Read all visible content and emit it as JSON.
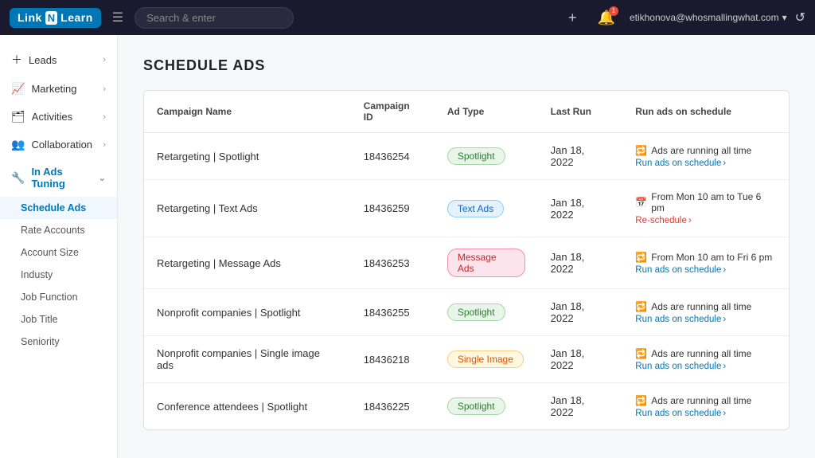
{
  "app": {
    "logo_text_left": "Link",
    "logo_n": "N",
    "logo_text_right": "Learn"
  },
  "topnav": {
    "search_placeholder": "Search & enter",
    "plus_icon": "+",
    "notification_count": "1",
    "user_email": "etikhonova@whosmallingwhat.com",
    "chevron": "▾",
    "refresh_icon": "↺"
  },
  "sidebar": {
    "items": [
      {
        "id": "leads",
        "label": "Leads",
        "icon": "＋",
        "has_chevron": true
      },
      {
        "id": "marketing",
        "label": "Marketing",
        "icon": "📈",
        "has_chevron": true
      },
      {
        "id": "activities",
        "label": "Activities",
        "icon": "🗂",
        "has_chevron": true
      },
      {
        "id": "collaboration",
        "label": "Collaboration",
        "icon": "👥",
        "has_chevron": true
      },
      {
        "id": "in-ads-tuning",
        "label": "In Ads Tuning",
        "icon": "🔧",
        "active": true,
        "has_chevron": true
      }
    ],
    "subitems": [
      {
        "id": "schedule-ads",
        "label": "Schedule Ads",
        "active": true
      },
      {
        "id": "rate-accounts",
        "label": "Rate Accounts"
      },
      {
        "id": "account-size",
        "label": "Account Size"
      },
      {
        "id": "industy",
        "label": "Industy"
      },
      {
        "id": "job-function",
        "label": "Job Function"
      },
      {
        "id": "job-title",
        "label": "Job Title"
      },
      {
        "id": "seniority",
        "label": "Seniority"
      }
    ]
  },
  "page": {
    "title": "SCHEDULE ADS"
  },
  "table": {
    "columns": [
      "Campaign Name",
      "Campaign ID",
      "Ad Type",
      "Last Run",
      "Run ads on schedule"
    ],
    "rows": [
      {
        "campaign_name": "Retargeting | Spotlight",
        "campaign_id": "18436254",
        "ad_type": "Spotlight",
        "ad_type_class": "spotlight",
        "last_run": "Jan 18, 2022",
        "schedule_title": "Ads are running all time",
        "schedule_link": "Run ads on schedule",
        "schedule_link_class": "normal",
        "icon": "🔁"
      },
      {
        "campaign_name": "Retargeting | Text Ads",
        "campaign_id": "18436259",
        "ad_type": "Text Ads",
        "ad_type_class": "text-ads",
        "last_run": "Jan 18, 2022",
        "schedule_title": "From Mon 10 am to Tue 6 pm",
        "schedule_link": "Re-schedule",
        "schedule_link_class": "reschedule",
        "icon": "📅"
      },
      {
        "campaign_name": "Retargeting | Message Ads",
        "campaign_id": "18436253",
        "ad_type": "Message Ads",
        "ad_type_class": "message-ads",
        "last_run": "Jan 18, 2022",
        "schedule_title": "From Mon 10 am to Fri 6 pm",
        "schedule_link": "Run ads on schedule",
        "schedule_link_class": "normal",
        "icon": "🔁"
      },
      {
        "campaign_name": "Nonprofit companies | Spotlight",
        "campaign_id": "18436255",
        "ad_type": "Spotlight",
        "ad_type_class": "spotlight",
        "last_run": "Jan 18, 2022",
        "schedule_title": "Ads are running all time",
        "schedule_link": "Run ads on schedule",
        "schedule_link_class": "normal",
        "icon": "🔁"
      },
      {
        "campaign_name": "Nonprofit companies | Single image ads",
        "campaign_id": "18436218",
        "ad_type": "Single Image",
        "ad_type_class": "single-image",
        "last_run": "Jan 18, 2022",
        "schedule_title": "Ads are running all time",
        "schedule_link": "Run ads on schedule",
        "schedule_link_class": "normal",
        "icon": "🔁"
      },
      {
        "campaign_name": "Conference attendees | Spotlight",
        "campaign_id": "18436225",
        "ad_type": "Spotlight",
        "ad_type_class": "spotlight",
        "last_run": "Jan 18, 2022",
        "schedule_title": "Ads are running all time",
        "schedule_link": "Run ads on schedule",
        "schedule_link_class": "normal",
        "icon": "🔁"
      }
    ]
  }
}
